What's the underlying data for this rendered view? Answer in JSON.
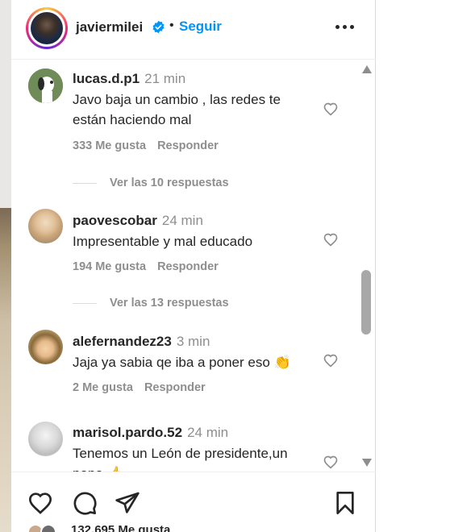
{
  "header": {
    "username": "javiermilei",
    "separator": "•",
    "follow_label": "Seguir"
  },
  "comments": [
    {
      "username": "lucas.d.p1",
      "time": "21 min",
      "text": "Javo baja un cambio , las redes te están haciendo mal",
      "likes": "333 Me gusta",
      "reply_label": "Responder",
      "view_replies": "Ver las 10 respuestas"
    },
    {
      "username": "paovescobar",
      "time": "24 min",
      "text": "Impresentable y mal educado",
      "likes": "194 Me gusta",
      "reply_label": "Responder",
      "view_replies": "Ver las 13 respuestas"
    },
    {
      "username": "alefernandez23",
      "time": "3 min",
      "text": "Jaja ya sabia qe iba a poner eso 👏",
      "likes": "2 Me gusta",
      "reply_label": "Responder"
    },
    {
      "username": "marisol.pardo.52",
      "time": "24 min",
      "text": "Tenemos un León de presidente,un papa 👍",
      "likes": "",
      "reply_label": ""
    }
  ],
  "footer": {
    "likes_partial": "132.695 Me gusta"
  },
  "colors": {
    "accent": "#0095f6",
    "verified": "#0095f6",
    "text": "#262626",
    "secondary": "#8e8e8e"
  },
  "icons": [
    "verified-badge-icon",
    "more-options-icon",
    "heart-icon",
    "comment-icon",
    "share-icon",
    "bookmark-icon",
    "scroll-up-arrow-icon",
    "scroll-down-arrow-icon"
  ]
}
